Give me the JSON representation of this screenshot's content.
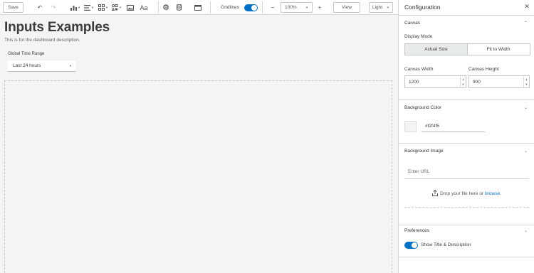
{
  "toolbar": {
    "save_label": "Save",
    "gridlines_label": "Gridlines",
    "gridlines_on": true,
    "zoom_value": "100%",
    "zoom_out_icon": "minus",
    "zoom_in_icon": "plus",
    "view_label": "View",
    "theme_value": "Light",
    "text_label": "Aa"
  },
  "canvas": {
    "title": "Inputs Examples",
    "description": "This is for the dashboard description.",
    "time_range_label": "Global Time Range",
    "time_range_value": "Last 24 hours"
  },
  "panel": {
    "title": "Configuration",
    "canvas_section": "Canvas",
    "display_mode_label": "Display Mode",
    "display_modes": [
      "Actual Size",
      "Fit to Width"
    ],
    "selected_display_mode": "Actual Size",
    "width_label": "Canvas Width",
    "width_value": "1200",
    "height_label": "Canvas Height",
    "height_value": "900",
    "bg_color_label": "Background Color",
    "bg_color_value": "#f2f4f5",
    "bg_image_label": "Background Image",
    "url_placeholder": "Enter URL",
    "drop_text": "Drop your file here or",
    "browse_label": "browse.",
    "preferences_label": "Preferences",
    "show_title_label": "Show Title & Description",
    "show_title_on": true
  },
  "colors": {
    "accent": "#0071c5",
    "canvas_bg": "#f2f4f5",
    "selected_segment_bg": "#e8ebec"
  }
}
